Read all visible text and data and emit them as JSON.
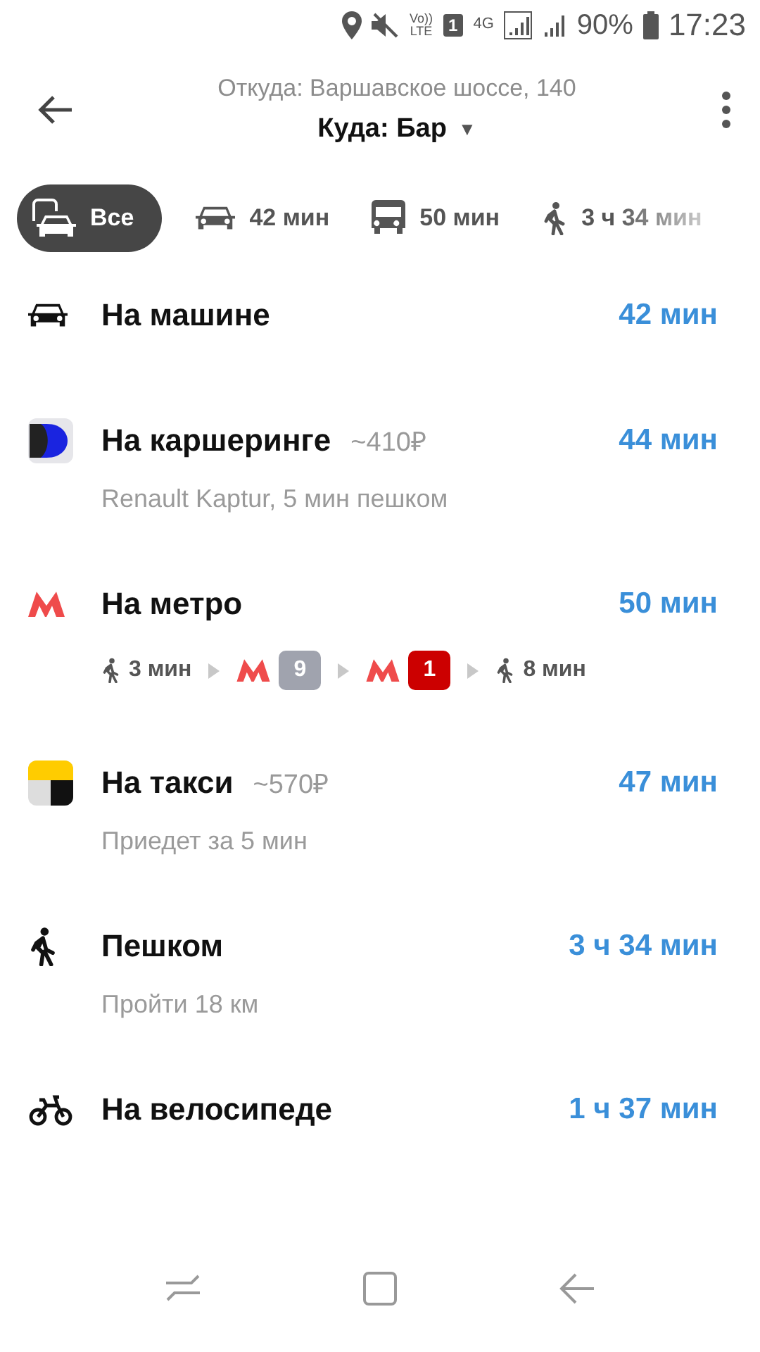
{
  "status_bar": {
    "sim": "1",
    "network": "4G",
    "volte_top": "Vo))",
    "volte_bottom": "LTE",
    "battery": "90%",
    "time": "17:23"
  },
  "header": {
    "from": "Откуда: Варшавское шоссе, 140",
    "to": "Куда: Бар",
    "caret": "▼"
  },
  "tabs": [
    {
      "kind": "all",
      "label": "Все",
      "selected": true
    },
    {
      "kind": "car",
      "label": "42 мин",
      "selected": false
    },
    {
      "kind": "bus",
      "label": "50 мин",
      "selected": false
    },
    {
      "kind": "walk",
      "label": "3 ч 34 мин",
      "selected": false
    }
  ],
  "routes": [
    {
      "kind": "car",
      "title": "На машине",
      "time": "42 мин"
    },
    {
      "kind": "carsharing",
      "title": "На каршеринге",
      "price": "~410₽",
      "time": "44 мин",
      "subtitle": "Renault Kaptur, 5 мин пешком"
    },
    {
      "kind": "metro",
      "title": "На метро",
      "time": "50 мин",
      "steps": [
        {
          "kind": "walk",
          "text": "3 мин"
        },
        {
          "kind": "line",
          "text": "9",
          "color": "#a0a3ae"
        },
        {
          "kind": "line",
          "text": "1",
          "color": "#cc0000"
        },
        {
          "kind": "walk",
          "text": "8 мин"
        }
      ]
    },
    {
      "kind": "taxi",
      "title": "На такси",
      "price": "~570₽",
      "time": "47 мин",
      "subtitle": "Приедет за 5 мин"
    },
    {
      "kind": "walk",
      "title": "Пешком",
      "time": "3 ч 34 мин",
      "subtitle": "Пройти 18 км"
    },
    {
      "kind": "bike",
      "title": "На велосипеде",
      "time": "1 ч 37 мин"
    }
  ]
}
